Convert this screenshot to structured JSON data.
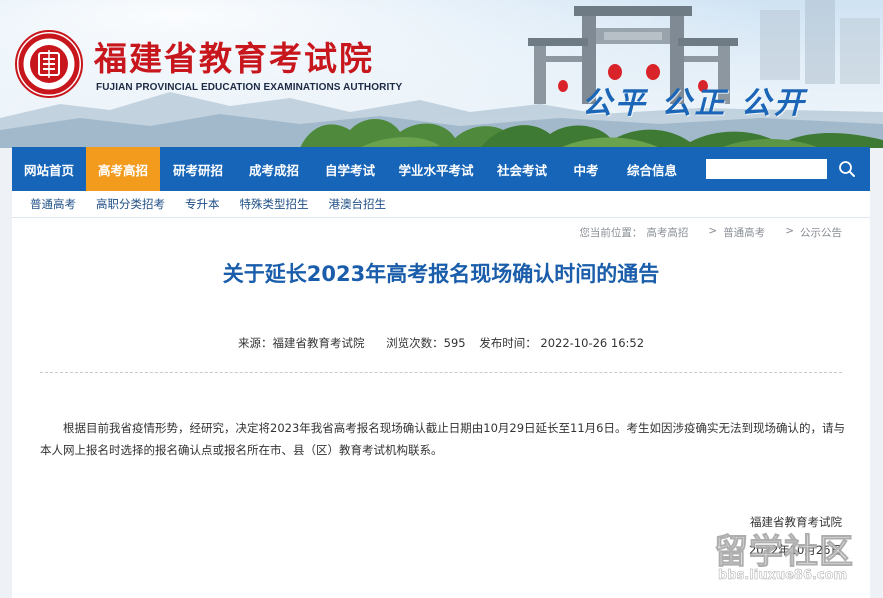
{
  "header": {
    "title": "福建省教育考试院",
    "subtitle": "FUJIAN PROVINCIAL EDUCATION EXAMINATIONS AUTHORITY",
    "slogan": "公平  公正  公开",
    "logo_icon": "exam-authority-seal-icon"
  },
  "nav": {
    "items": [
      {
        "label": "网站首页"
      },
      {
        "label": "高考高招"
      },
      {
        "label": "研考研招"
      },
      {
        "label": "成考成招"
      },
      {
        "label": "自学考试"
      },
      {
        "label": "学业水平考试"
      },
      {
        "label": "社会考试"
      },
      {
        "label": "中考"
      },
      {
        "label": "综合信息"
      }
    ],
    "active_index": 1,
    "search": {
      "value": "",
      "placeholder": "",
      "icon": "search-icon"
    }
  },
  "subnav": {
    "items": [
      {
        "label": "普通高考"
      },
      {
        "label": "高职分类招考"
      },
      {
        "label": "专升本"
      },
      {
        "label": "特殊类型招生"
      },
      {
        "label": "港澳台招生"
      }
    ]
  },
  "breadcrumb": {
    "prefix": "您当前位置：",
    "items": [
      "高考高招",
      "普通高考",
      "公示公告"
    ],
    "separator": ">"
  },
  "article": {
    "title": "关于延长2023年高考报名现场确认时间的通告",
    "source_label": "来源：福建省教育考试院",
    "views_label": "浏览次数：595",
    "published_label": "发布时间： 2022-10-26 16:52",
    "body": "根据目前我省疫情形势，经研究，决定将2023年我省高考报名现场确认截止日期由10月29日延长至11月6日。考生如因涉疫确实无法到现场确认的，请与本人网上报名时选择的报名确认点或报名所在市、县（区）教育考试机构联系。",
    "signature_org": "福建省教育考试院",
    "signature_date": "2022年10月26日"
  },
  "watermark": {
    "main": "留学社区",
    "url": "bbs.liuxue86.com"
  },
  "colors": {
    "nav_bg": "#1665b8",
    "nav_active": "#f39b1c",
    "title_red": "#c8161d",
    "article_title": "#1a5daa",
    "slogan": "#1c66b8"
  }
}
